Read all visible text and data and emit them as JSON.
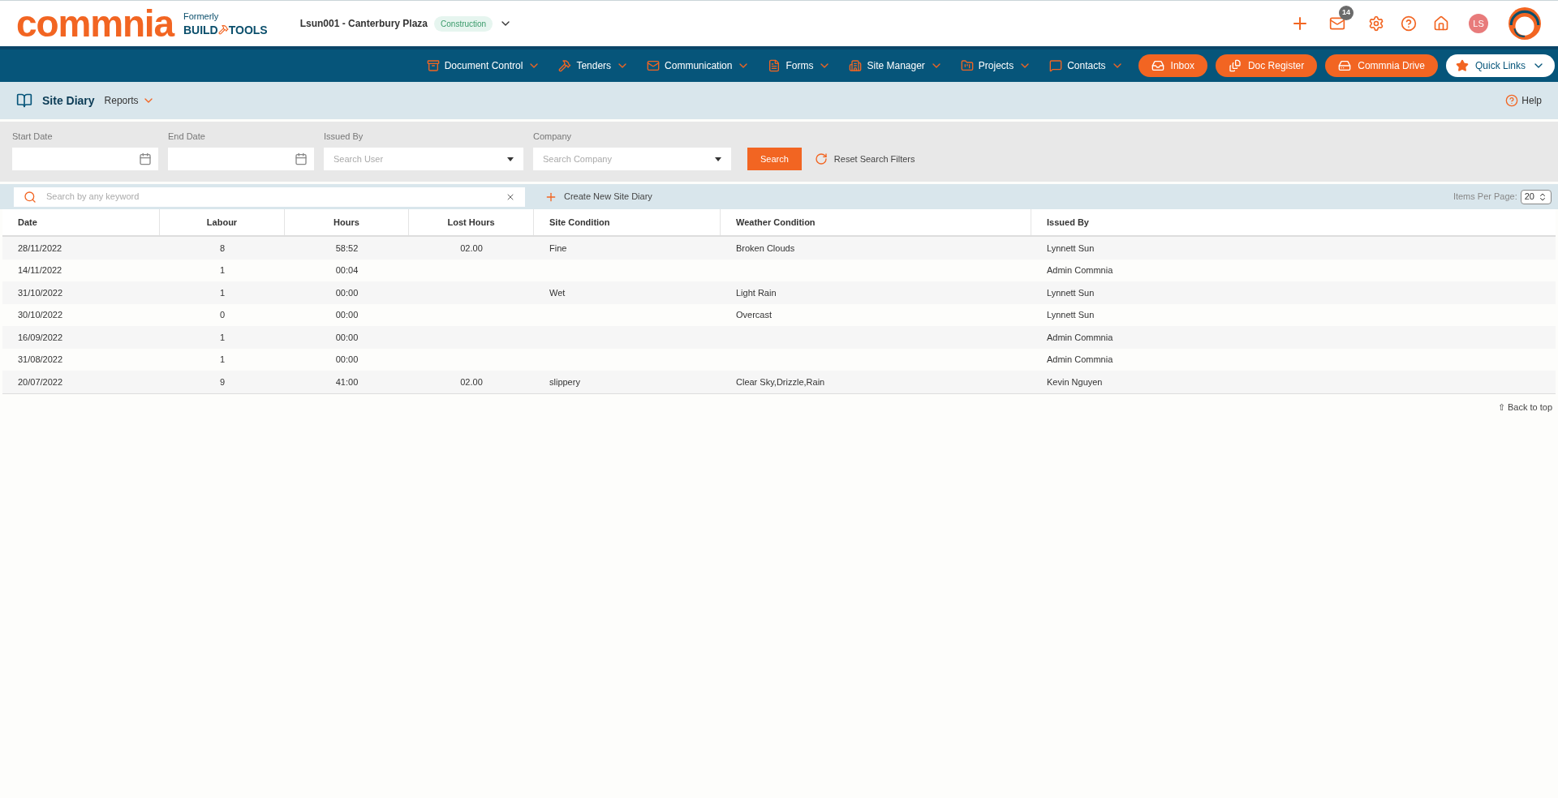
{
  "header": {
    "logo": "commnia",
    "formerly": "Formerly",
    "brand_left": "BUILD",
    "brand_right": "TOOLS",
    "project": "Lsun001 - Canterbury Plaza",
    "project_tag": "Construction",
    "mail_count": "14",
    "user_initials": "LS"
  },
  "nav": {
    "items": [
      {
        "label": "Document Control"
      },
      {
        "label": "Tenders"
      },
      {
        "label": "Communication"
      },
      {
        "label": "Forms"
      },
      {
        "label": "Site Manager"
      },
      {
        "label": "Projects"
      },
      {
        "label": "Contacts"
      }
    ],
    "buttons": [
      {
        "label": "Inbox"
      },
      {
        "label": "Doc Register"
      },
      {
        "label": "Commnia Drive"
      }
    ],
    "quick_links": "Quick Links"
  },
  "page_header": {
    "title": "Site Diary",
    "reports": "Reports",
    "help": "Help"
  },
  "filters": [
    {
      "kind": "date",
      "label": "Start Date"
    },
    {
      "kind": "date",
      "label": "End Date"
    },
    {
      "kind": "select",
      "label": "Issued By",
      "placeholder": "Search User"
    },
    {
      "kind": "select",
      "label": "Company",
      "placeholder": "Search Company"
    }
  ],
  "search_button": "Search",
  "reset": "Reset Search Filters",
  "toolbar": {
    "keyword_placeholder": "Search by any keyword",
    "create": "Create New Site Diary",
    "items_per_page_label": "Items Per Page:",
    "items_per_page": "20"
  },
  "table": {
    "columns": [
      {
        "label": "Date"
      },
      {
        "label": "Labour"
      },
      {
        "label": "Hours"
      },
      {
        "label": "Lost Hours"
      },
      {
        "label": "Site Condition"
      },
      {
        "label": "Weather Condition"
      },
      {
        "label": "Issued By"
      }
    ],
    "rows": [
      [
        "28/11/2022",
        "8",
        "58:52",
        "02.00",
        "Fine",
        "Broken Clouds",
        "Lynnett Sun"
      ],
      [
        "14/11/2022",
        "1",
        "00:04",
        "",
        "",
        "",
        "Admin Commnia"
      ],
      [
        "31/10/2022",
        "1",
        "00:00",
        "",
        "Wet",
        "Light Rain",
        "Lynnett Sun"
      ],
      [
        "30/10/2022",
        "0",
        "00:00",
        "",
        "",
        "Overcast",
        "Lynnett Sun"
      ],
      [
        "16/09/2022",
        "1",
        "00:00",
        "",
        "",
        "",
        "Admin Commnia"
      ],
      [
        "31/08/2022",
        "1",
        "00:00",
        "",
        "",
        "",
        "Admin Commnia"
      ],
      [
        "20/07/2022",
        "9",
        "41:00",
        "02.00",
        "slippery",
        "Clear Sky,Drizzle,Rain",
        "Kevin Nguyen"
      ]
    ]
  },
  "back_to_top": "⇧ Back to top"
}
